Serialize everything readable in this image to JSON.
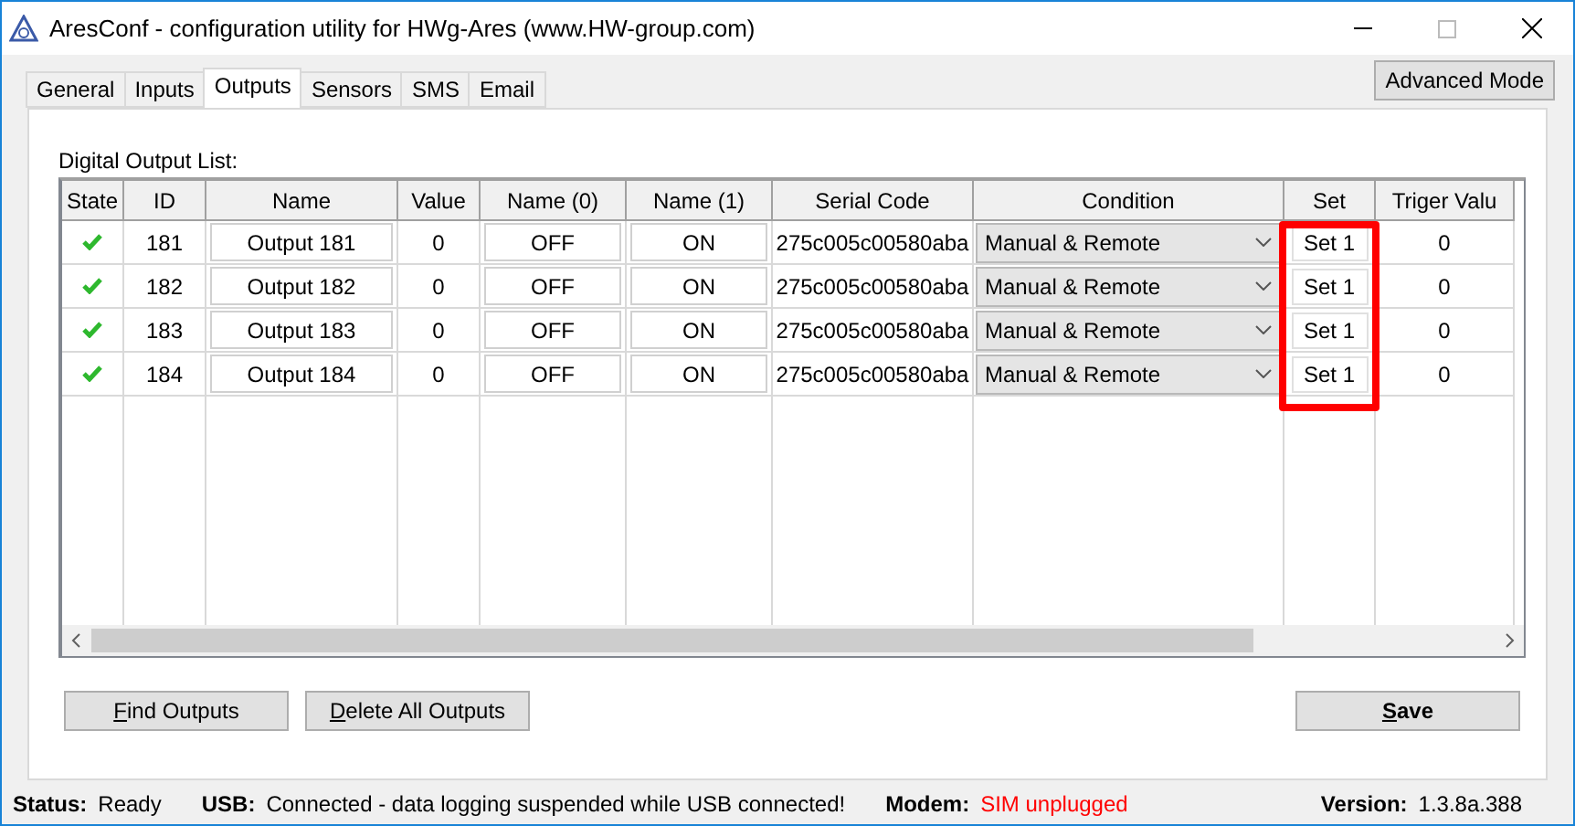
{
  "window": {
    "title": "AresConf - configuration utility for HWg-Ares (www.HW-group.com)"
  },
  "tabs": [
    {
      "label": "General",
      "selected": false
    },
    {
      "label": "Inputs",
      "selected": false
    },
    {
      "label": "Outputs",
      "selected": true
    },
    {
      "label": "Sensors",
      "selected": false
    },
    {
      "label": "SMS",
      "selected": false
    },
    {
      "label": "Email",
      "selected": false
    }
  ],
  "advanced_button": "Advanced Mode",
  "list_label": "Digital Output List:",
  "table": {
    "columns": [
      "State",
      "ID",
      "Name",
      "Value",
      "Name (0)",
      "Name (1)",
      "Serial Code",
      "Condition",
      "Set",
      "Triger Valu"
    ],
    "rows": [
      {
        "state_ok": true,
        "id": "181",
        "name": "Output 181",
        "value": "0",
        "name0": "OFF",
        "name1": "ON",
        "serial": "275c005c00580aba",
        "condition": "Manual & Remote",
        "set": "Set 1",
        "trigger": "0"
      },
      {
        "state_ok": true,
        "id": "182",
        "name": "Output 182",
        "value": "0",
        "name0": "OFF",
        "name1": "ON",
        "serial": "275c005c00580aba",
        "condition": "Manual & Remote",
        "set": "Set 1",
        "trigger": "0"
      },
      {
        "state_ok": true,
        "id": "183",
        "name": "Output 183",
        "value": "0",
        "name0": "OFF",
        "name1": "ON",
        "serial": "275c005c00580aba",
        "condition": "Manual & Remote",
        "set": "Set 1",
        "trigger": "0"
      },
      {
        "state_ok": true,
        "id": "184",
        "name": "Output 184",
        "value": "0",
        "name0": "OFF",
        "name1": "ON",
        "serial": "275c005c00580aba",
        "condition": "Manual & Remote",
        "set": "Set 1",
        "trigger": "0"
      }
    ],
    "highlight_set_column": true
  },
  "buttons": [
    {
      "label": "Find Outputs",
      "underline_first": true,
      "bold": false
    },
    {
      "label": "Delete All Outputs",
      "underline_first": true,
      "bold": false
    },
    {
      "label": "Save",
      "underline_first": true,
      "bold": true
    }
  ],
  "status_bar": [
    {
      "label": "Status:",
      "value": "Ready",
      "alert": false
    },
    {
      "label": "USB:",
      "value": "Connected - data logging suspended while USB connected!",
      "alert": false
    },
    {
      "label": "Modem:",
      "value": "SIM unplugged",
      "alert": true
    },
    {
      "label": "Version:",
      "value": "1.3.8a.388",
      "alert": false
    }
  ]
}
